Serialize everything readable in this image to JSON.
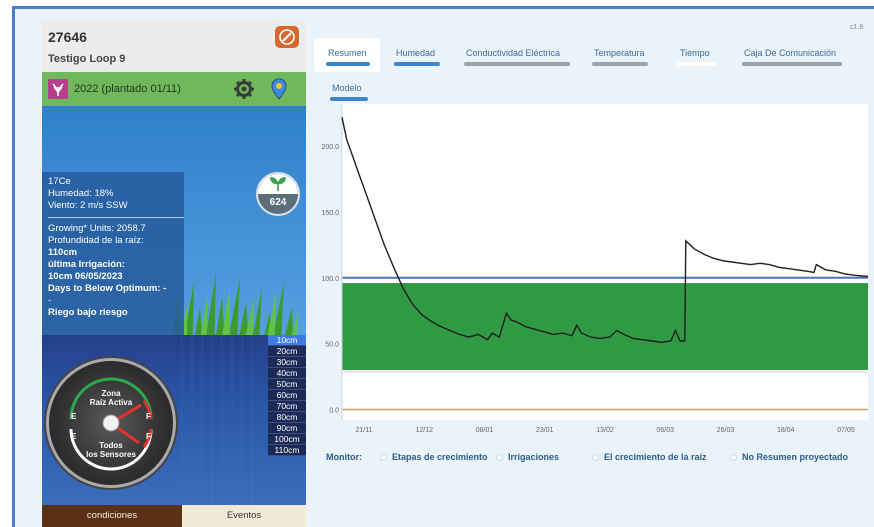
{
  "station": {
    "id": "27646",
    "name": "Testigo Loop 9"
  },
  "season": {
    "label": "2022 (plantado 01/11)"
  },
  "weather": {
    "temperature": "17Ce",
    "humidity": "Humedad: 18%",
    "wind": "Viento: 2 m/s SSW",
    "growing_units": "Growing* Units: 2058.7",
    "root_depth_label": "Profundidad de la raíz:",
    "root_depth_value": "110cm",
    "last_irrigation_label": "última Irrigación:",
    "last_irrigation_value": "10cm  06/05/2023",
    "days_below_optimum": "Days to Below Optimum: -",
    "extra_line": "-",
    "cut_line": "Riego bajo riesgo"
  },
  "gdu_badge": {
    "value": "624",
    "icon": "leaf-icon"
  },
  "depths": [
    "10cm",
    "20cm",
    "30cm",
    "40cm",
    "50cm",
    "60cm",
    "70cm",
    "80cm",
    "90cm",
    "100cm",
    "110cm"
  ],
  "gauge": {
    "top_line1": "Zona",
    "top_line2": "Raíz Activa",
    "bottom_line1": "Todos",
    "bottom_line2": "los Sensores",
    "e_label": "E",
    "f_label": "F"
  },
  "bottom_tabs": {
    "conditions": "condiciones",
    "events": "Eventos"
  },
  "corner_text": "c1.8",
  "nav_tabs": [
    {
      "label": "Resumen",
      "color": "#3a86c8"
    },
    {
      "label": "Humedad",
      "color": "#3a86c8"
    },
    {
      "label": "Conductividad Eléctrica",
      "color": "#9aa2aa"
    },
    {
      "label": "Temperatura",
      "color": "#9aa2aa"
    },
    {
      "label": "Tiempo",
      "color": "#ffffff"
    },
    {
      "label": "Caja De Comunicación",
      "color": "#9aa2aa"
    },
    {
      "label": "Modelo",
      "color": "#3a86c8"
    }
  ],
  "monitor": {
    "label": "Monitor:",
    "items": [
      "Etapas de crecimiento",
      "Irrigaciones",
      "El crecimiento de la raíz",
      "No Resumen proyectado"
    ]
  },
  "chart_data": {
    "type": "line",
    "x_ticks": [
      "21/11",
      "12/12",
      "08/01",
      "23/01",
      "13/02",
      "06/03",
      "26/03",
      "18/04",
      "07/05"
    ],
    "y_ticks": [
      0.0,
      50.0,
      100.0,
      150.0,
      200.0
    ],
    "ylim": [
      -8,
      232
    ],
    "optimal_band": [
      30,
      96
    ],
    "full_line": 100,
    "refill_line": 0,
    "series": [
      {
        "values": [
          [
            0.0,
            222
          ],
          [
            0.1,
            205
          ],
          [
            0.2,
            195
          ],
          [
            0.35,
            180
          ],
          [
            0.5,
            165
          ],
          [
            0.7,
            145
          ],
          [
            0.9,
            125
          ],
          [
            1.1,
            108
          ],
          [
            1.3,
            92
          ],
          [
            1.5,
            80
          ],
          [
            1.7,
            72
          ],
          [
            1.9,
            67
          ],
          [
            2.1,
            63
          ],
          [
            2.3,
            60
          ],
          [
            2.5,
            57
          ],
          [
            2.7,
            55
          ],
          [
            2.9,
            57
          ],
          [
            3.1,
            53
          ],
          [
            3.2,
            58
          ],
          [
            3.35,
            55
          ],
          [
            3.5,
            73
          ],
          [
            3.6,
            68
          ],
          [
            3.75,
            66
          ],
          [
            3.9,
            63
          ],
          [
            4.1,
            61
          ],
          [
            4.3,
            59
          ],
          [
            4.5,
            57
          ],
          [
            4.7,
            58
          ],
          [
            4.9,
            56
          ],
          [
            5.0,
            64
          ],
          [
            5.1,
            58
          ],
          [
            5.3,
            55
          ],
          [
            5.5,
            54
          ],
          [
            5.7,
            55
          ],
          [
            5.85,
            60
          ],
          [
            6.0,
            57
          ],
          [
            6.2,
            54
          ],
          [
            6.4,
            53
          ],
          [
            6.6,
            52
          ],
          [
            6.8,
            51
          ],
          [
            7.0,
            52
          ],
          [
            7.1,
            60
          ],
          [
            7.2,
            52
          ],
          [
            7.3,
            52
          ],
          [
            7.32,
            128
          ],
          [
            7.5,
            122
          ],
          [
            7.7,
            118
          ],
          [
            7.9,
            115
          ],
          [
            8.1,
            113
          ],
          [
            8.3,
            112
          ],
          [
            8.5,
            111
          ],
          [
            8.7,
            110
          ],
          [
            8.9,
            111
          ],
          [
            9.1,
            110
          ],
          [
            9.3,
            108
          ],
          [
            9.5,
            107
          ],
          [
            9.7,
            106
          ],
          [
            9.9,
            105
          ],
          [
            10.05,
            104
          ],
          [
            10.1,
            110
          ],
          [
            10.3,
            106
          ],
          [
            10.5,
            105
          ],
          [
            10.7,
            103
          ],
          [
            10.9,
            102
          ],
          [
            11.2,
            101
          ]
        ]
      }
    ],
    "x_range": [
      0,
      11.2
    ],
    "grid": false,
    "legend": "bottom"
  }
}
